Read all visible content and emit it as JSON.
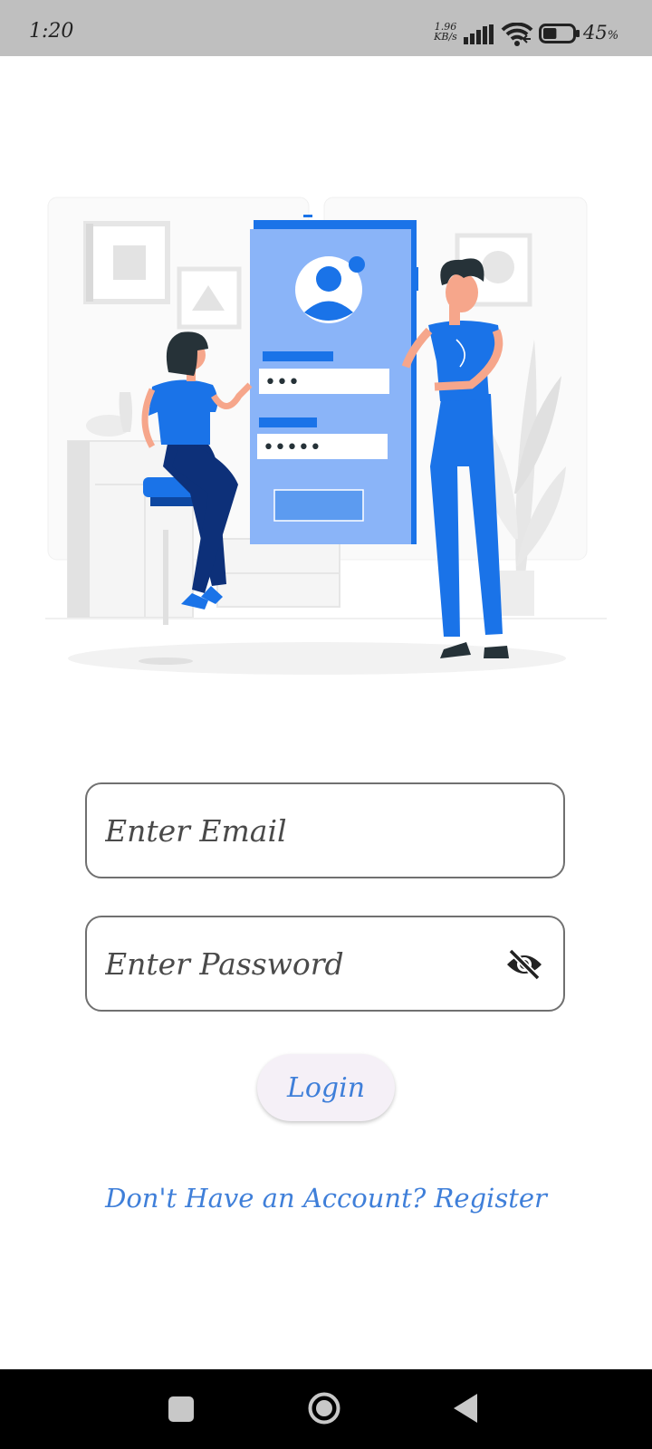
{
  "status_bar": {
    "time": "1:20",
    "net_speed_value": "1.96",
    "net_speed_unit": "KB/s",
    "battery_percent": "45",
    "battery_unit": "%",
    "battery_level": 0.45,
    "icons": [
      "signal-icon",
      "wifi-icon",
      "battery-icon"
    ]
  },
  "illustration": {
    "description_icon": "login-illustration",
    "accent_color": "#1a73e8",
    "password_dots_top": "•••",
    "password_dots_bottom": "•••••"
  },
  "form": {
    "email_placeholder": "Enter Email",
    "email_value": "",
    "password_placeholder": "Enter Password",
    "password_value": "",
    "visibility_icon": "eye-off-icon",
    "login_label": "Login",
    "register_text": "Don't Have an Account? Register"
  },
  "colors": {
    "accent": "#3f7fd9",
    "status_bar_bg": "#bfbfbf",
    "nav_bar_bg": "#000000",
    "button_bg": "#f5f0f7"
  },
  "nav_bar": {
    "icons": [
      "recent-apps-icon",
      "home-icon",
      "back-icon"
    ]
  }
}
